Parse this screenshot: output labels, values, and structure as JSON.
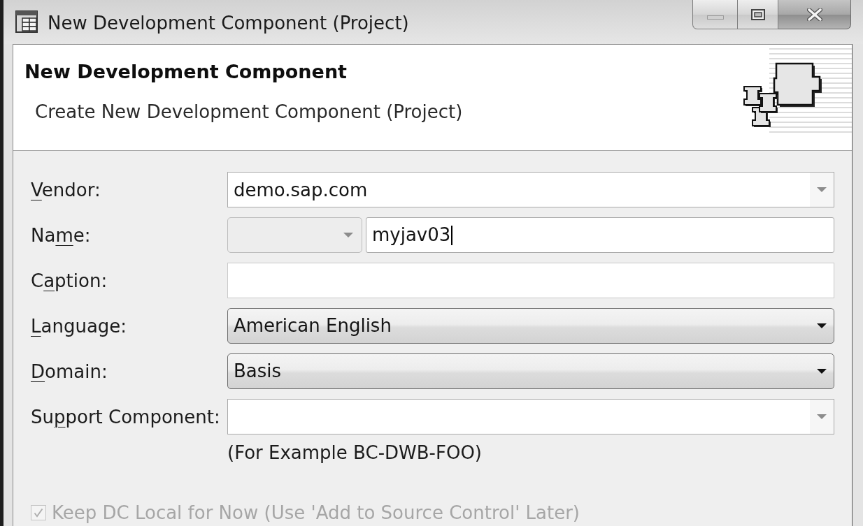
{
  "window": {
    "title": "New Development Component (Project)"
  },
  "header": {
    "title": "New Development Component",
    "subtitle": "Create New Development Component (Project)"
  },
  "form": {
    "fields": [
      {
        "kind": "editable-combo",
        "label": {
          "key": "V",
          "after": "endor:"
        },
        "value": "demo.sap.com"
      },
      {
        "kind": "prefixed-text",
        "label": {
          "before": "Na",
          "key": "m",
          "after": "e:"
        },
        "prefix": {
          "disabled": true
        },
        "value": "myjav03",
        "focused": true
      },
      {
        "kind": "text",
        "label": {
          "before": "C",
          "key": "a",
          "after": "ption:"
        }
      },
      {
        "kind": "combo",
        "label": {
          "key": "L",
          "after": "anguage:"
        },
        "value": "American English"
      },
      {
        "kind": "combo",
        "label": {
          "key": "D",
          "after": "omain:"
        },
        "value": "Basis"
      },
      {
        "kind": "editable-combo",
        "label": {
          "before": "Su",
          "key": "p",
          "after": "port Component:"
        },
        "example": "(For Example BC-DWB-FOO)"
      }
    ]
  },
  "local_checkbox": {
    "label": "Keep DC Local for Now (Use 'Add to Source Control' Later)",
    "checked": true,
    "disabled": true
  }
}
